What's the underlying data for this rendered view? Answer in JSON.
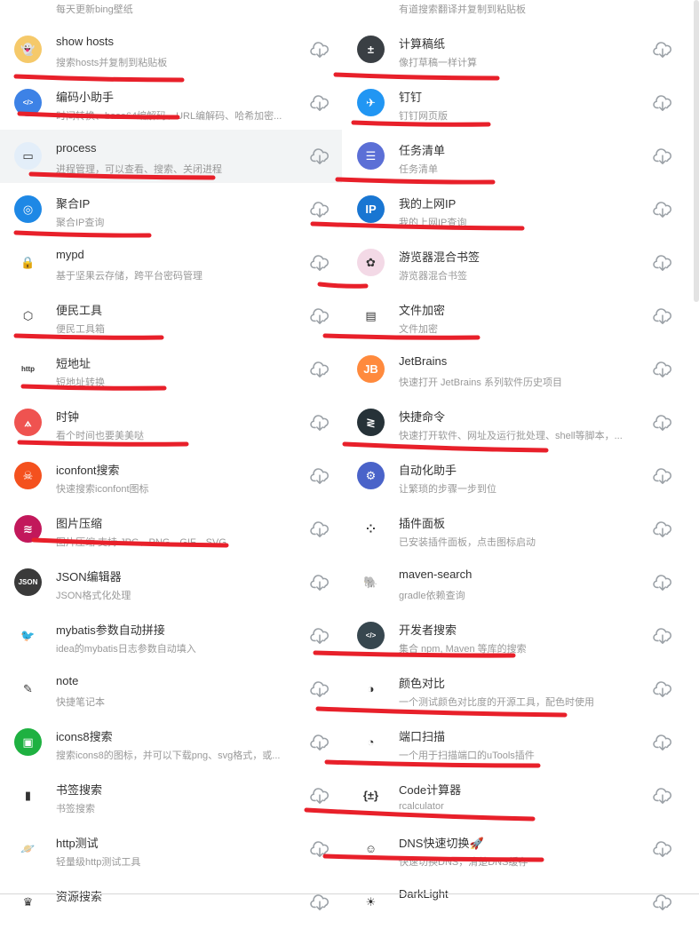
{
  "top_partial": {
    "left_desc": "每天更新bing壁纸",
    "right_desc": "有道搜索翻译并复制到粘贴板"
  },
  "plugins": [
    {
      "name": "show hosts",
      "desc": "搜索hosts并复制到粘贴板",
      "icon": "ghost-icon",
      "color": "#f5c96a"
    },
    {
      "name": "计算稿纸",
      "desc": "像打草稿一样计算",
      "icon": "calculator-icon",
      "color": "#3a3f44"
    },
    {
      "name": "编码小助手",
      "desc": "时间转换、base64编解码、URL编解码、哈希加密...",
      "icon": "code-icon",
      "color": "#3d82e6"
    },
    {
      "name": "钉钉",
      "desc": "钉钉网页版",
      "icon": "dingtalk-icon",
      "color": "#2196f3"
    },
    {
      "name": "process",
      "desc": "进程管理，可以查看、搜索、关闭进程",
      "icon": "monitor-icon",
      "color": "#e3eef9"
    },
    {
      "name": "任务清单",
      "desc": "任务清单",
      "icon": "list-icon",
      "color": "#5b6fd6"
    },
    {
      "name": "聚合IP",
      "desc": "聚合IP查询",
      "icon": "target-icon",
      "color": "#1e88e5"
    },
    {
      "name": "我的上网IP",
      "desc": "我的上网IP查询",
      "icon": "ip-icon",
      "color": "#1976d2"
    },
    {
      "name": "mypd",
      "desc": "基于坚果云存储，跨平台密码管理",
      "icon": "lock-icon",
      "color": "#ffffff"
    },
    {
      "name": "游览器混合书签",
      "desc": "游览器混合书签",
      "icon": "bookmark-planet-icon",
      "color": "#f3d9e6"
    },
    {
      "name": "便民工具",
      "desc": "便民工具箱",
      "icon": "cube-icon",
      "color": "#ffffff"
    },
    {
      "name": "文件加密",
      "desc": "文件加密",
      "icon": "file-lock-icon",
      "color": "#ffffff"
    },
    {
      "name": "短地址",
      "desc": "短地址转换",
      "icon": "link-icon",
      "color": "#ffffff"
    },
    {
      "name": "JetBrains",
      "desc": "快速打开 JetBrains 系列软件历史项目",
      "icon": "jetbrains-icon",
      "color": "#ff8a3d"
    },
    {
      "name": "时钟",
      "desc": "看个时间也要美美哒",
      "icon": "clock-icon",
      "color": "#ef5350"
    },
    {
      "name": "快捷命令",
      "desc": "快速打开软件、网址及运行批处理、shell等脚本，...",
      "icon": "command-icon",
      "color": "#263238"
    },
    {
      "name": "iconfont搜索",
      "desc": "快速搜索iconfont图标",
      "icon": "skull-icon",
      "color": "#f4511e"
    },
    {
      "name": "自动化助手",
      "desc": "让繁琐的步骤一步到位",
      "icon": "robot-arm-icon",
      "color": "#4a63c9"
    },
    {
      "name": "图片压缩",
      "desc": "图片压缩 支持 JPG、PNG、GIF、SVG",
      "icon": "layers-icon",
      "color": "#c2185b"
    },
    {
      "name": "插件面板",
      "desc": "已安装插件面板，点击图标启动",
      "icon": "grid-dots-icon",
      "color": "#ffffff"
    },
    {
      "name": "JSON编辑器",
      "desc": "JSON格式化处理",
      "icon": "json-icon",
      "color": "#3a3a3a"
    },
    {
      "name": "maven-search",
      "desc": "gradle依赖查询",
      "icon": "elephant-icon",
      "color": "#ffffff"
    },
    {
      "name": "mybatis参数自动拼接",
      "desc": "idea的mybatis日志参数自动填入",
      "icon": "bird-icon",
      "color": "#ffffff"
    },
    {
      "name": "开发者搜索",
      "desc": "集合 npm, Maven 等库的搜索",
      "icon": "terminal-icon",
      "color": "#37474f"
    },
    {
      "name": "note",
      "desc": "快捷笔记本",
      "icon": "notepad-icon",
      "color": "#ffffff"
    },
    {
      "name": "颜色对比",
      "desc": "一个测试颜色对比度的开源工具，配色时使用",
      "icon": "contrast-icon",
      "color": "#ffffff"
    },
    {
      "name": "icons8搜索",
      "desc": "搜索icons8的图标，并可以下载png、svg格式，或...",
      "icon": "icons8-icon",
      "color": "#1fb141"
    },
    {
      "name": "端口扫描",
      "desc": "一个用于扫描端口的uTools插件",
      "icon": "gauge-icon",
      "color": "#ffffff"
    },
    {
      "name": "书签搜索",
      "desc": "书签搜索",
      "icon": "bookmark-icon",
      "color": "#ffffff"
    },
    {
      "name": "Code计算器",
      "desc": "rcalculator",
      "icon": "code-calc-icon",
      "color": "#ffffff"
    },
    {
      "name": "http测试",
      "desc": "轻量级http测试工具",
      "icon": "planet-icon",
      "color": "#ffffff"
    },
    {
      "name": "DNS快速切换🚀",
      "desc": "快速切换DNS，清楚DNS缓存",
      "icon": "avatar-icon",
      "color": "#ffffff"
    },
    {
      "name": "资源搜索",
      "desc": "",
      "icon": "crown-icon",
      "color": "#ffffff"
    },
    {
      "name": "DarkLight",
      "desc": "",
      "icon": "sun-icon",
      "color": "#ffffff"
    }
  ],
  "download_icon": "cloud-download-icon",
  "highlight_index": 4,
  "colors": {
    "mark": "#e8202a",
    "icon_gray": "#9aa0a6"
  }
}
